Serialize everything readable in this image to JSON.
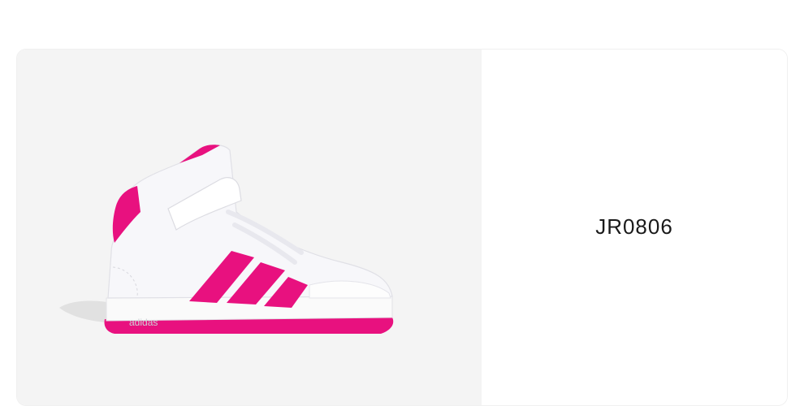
{
  "product": {
    "sku": "JR0806",
    "image_subject": "sneaker-icon",
    "image_logo_text": "adidas",
    "colors": {
      "panel_bg": "#f4f4f4",
      "shoe_white": "#f7f7fa",
      "accent_pink": "#e8117f"
    }
  }
}
